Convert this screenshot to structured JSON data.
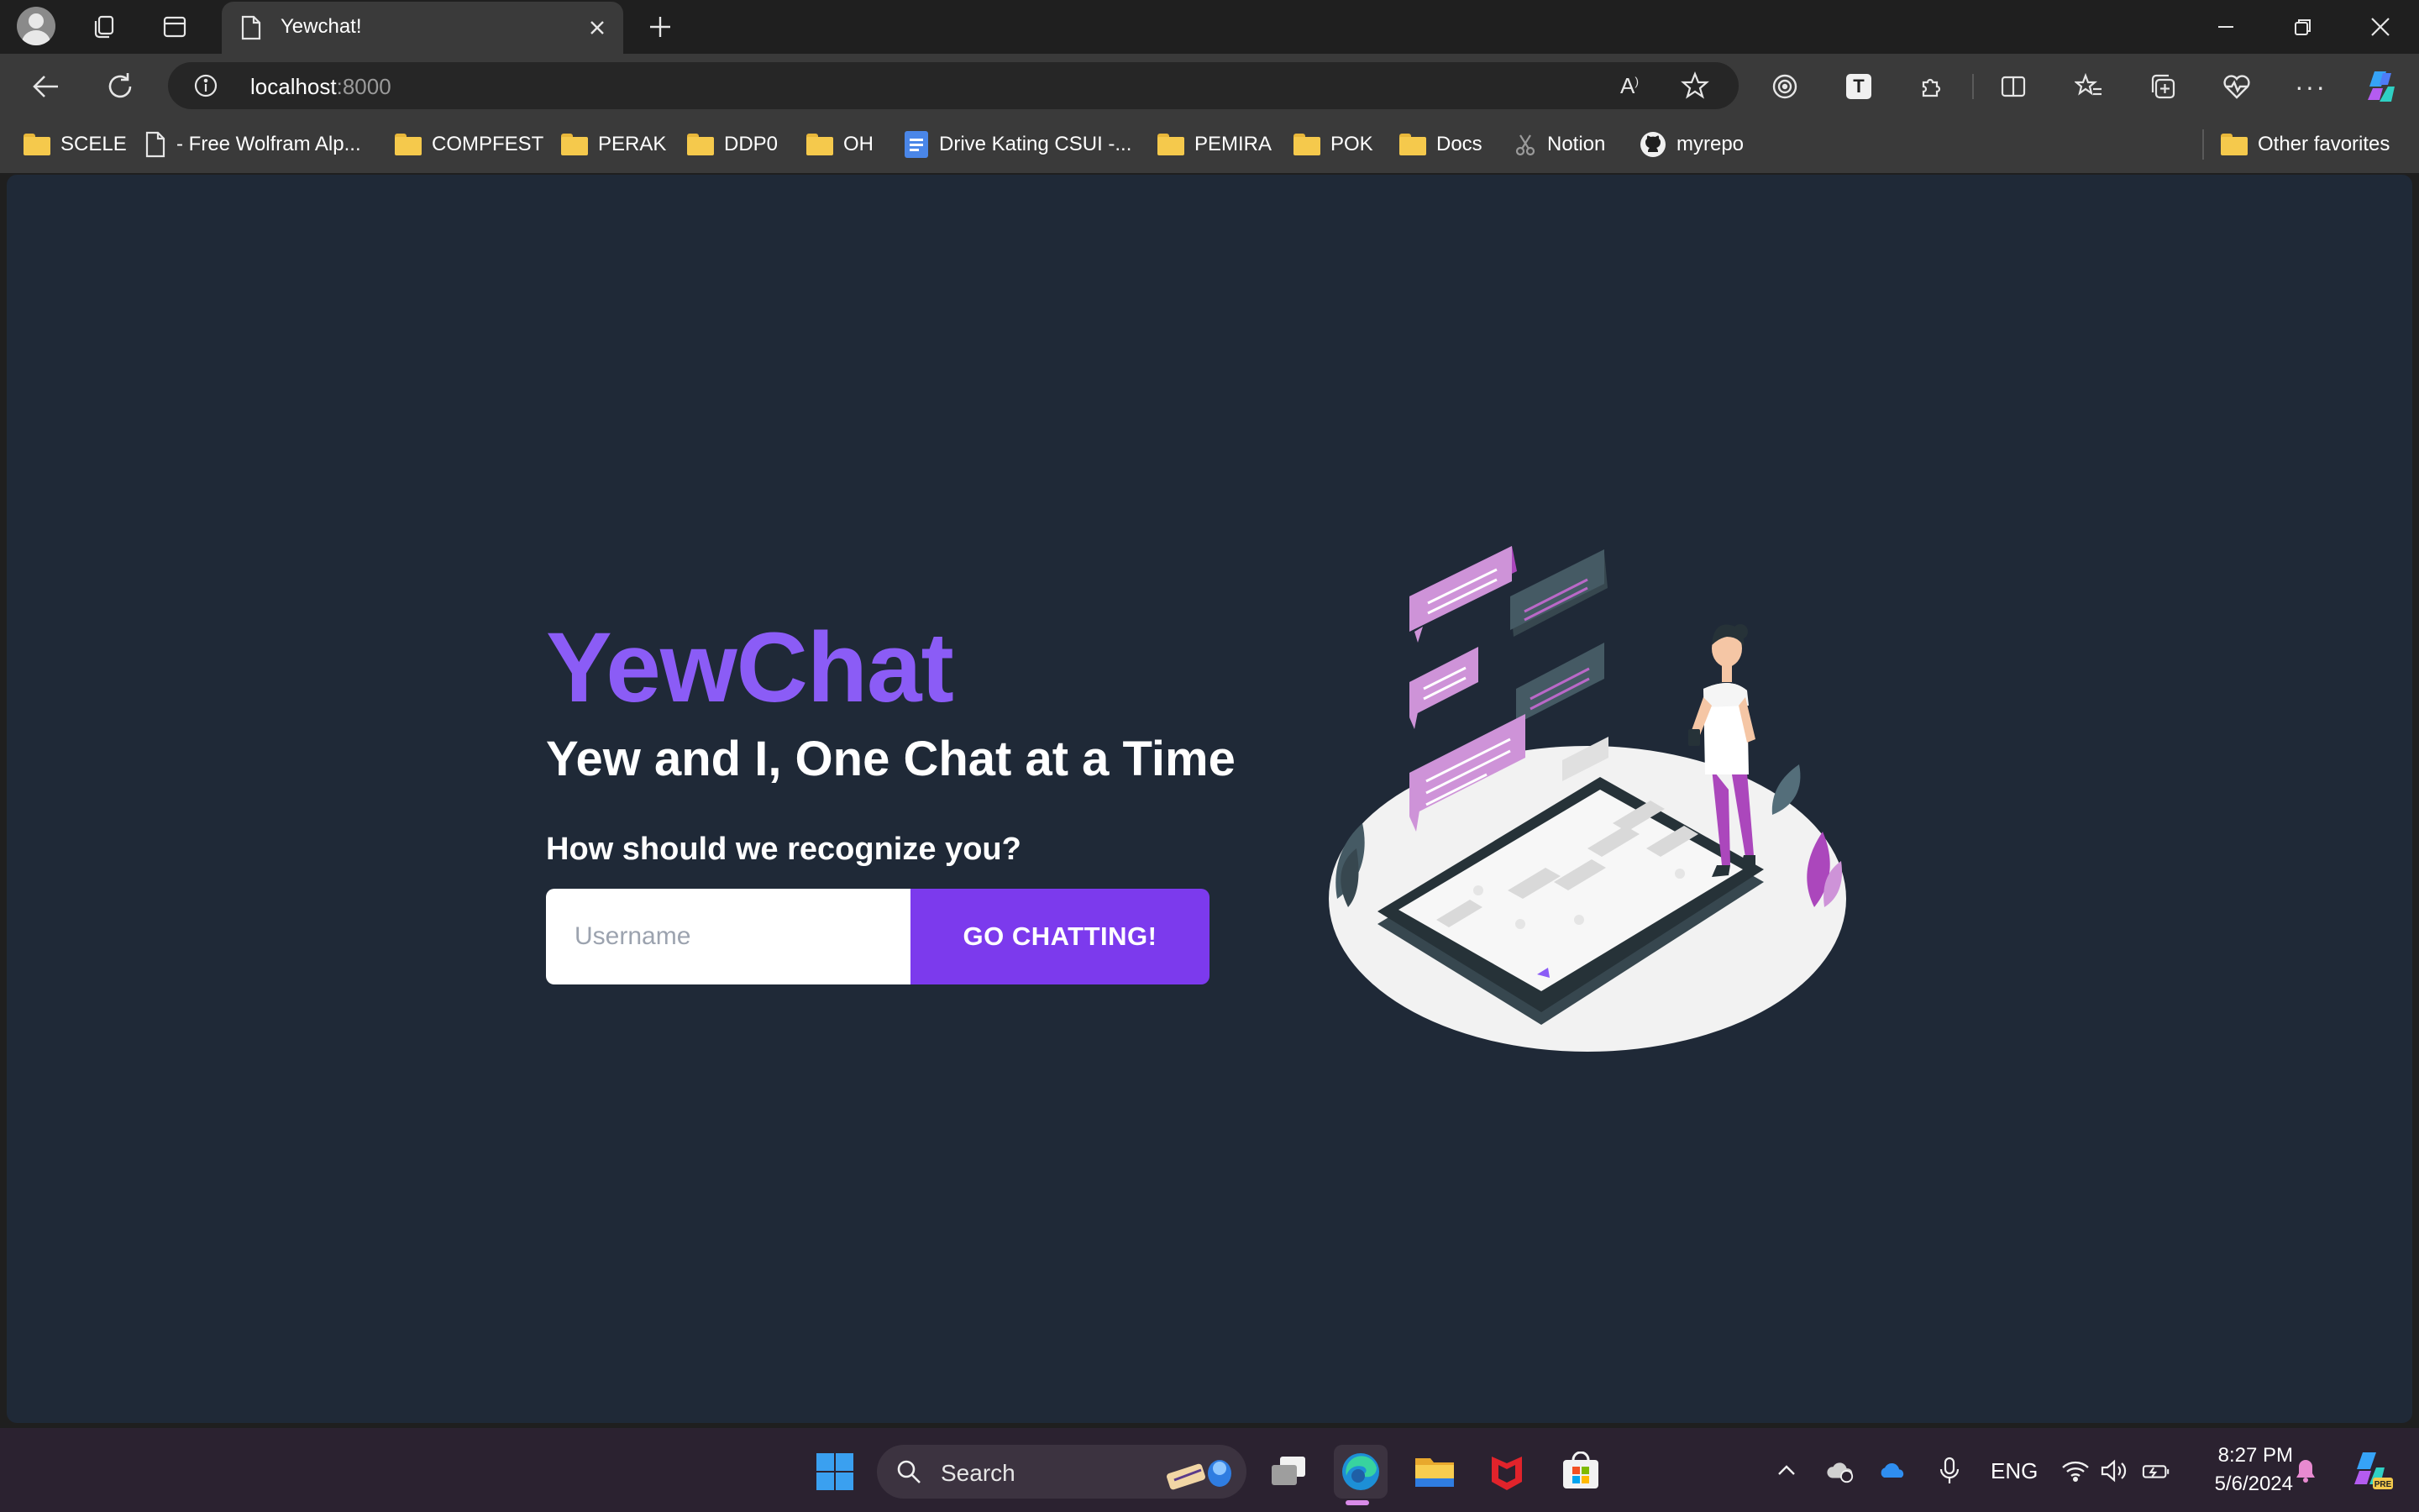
{
  "browser": {
    "tab_title": "Yewchat!",
    "url_host": "localhost",
    "url_port": ":8000",
    "bookmarks": [
      {
        "label": "SCELE",
        "icon": "folder-icon"
      },
      {
        "label": "- Free Wolfram Alp...",
        "icon": "page-icon"
      },
      {
        "label": "COMPFEST",
        "icon": "folder-icon"
      },
      {
        "label": "PERAK",
        "icon": "folder-icon"
      },
      {
        "label": "DDP0",
        "icon": "folder-icon"
      },
      {
        "label": "OH",
        "icon": "folder-icon"
      },
      {
        "label": "Drive Kating CSUI -...",
        "icon": "docs-icon"
      },
      {
        "label": "PEMIRA",
        "icon": "folder-icon"
      },
      {
        "label": "POK",
        "icon": "folder-icon"
      },
      {
        "label": "Docs",
        "icon": "folder-icon"
      },
      {
        "label": "Notion",
        "icon": "notion-icon"
      },
      {
        "label": "myrepo",
        "icon": "github-icon"
      }
    ],
    "other_favorites": "Other favorites"
  },
  "page": {
    "brand": "YewChat",
    "tagline": "Yew and I, One Chat at a Time",
    "prompt": "How should we recognize you?",
    "username_placeholder": "Username",
    "submit_label": "GO CHATTING!"
  },
  "taskbar": {
    "search_label": "Search",
    "language": "ENG",
    "time": "8:27 PM",
    "date": "5/6/2024"
  },
  "colors": {
    "brand": "#8b5cf6",
    "button": "#7c3aed",
    "page_background": "#1f2937"
  }
}
